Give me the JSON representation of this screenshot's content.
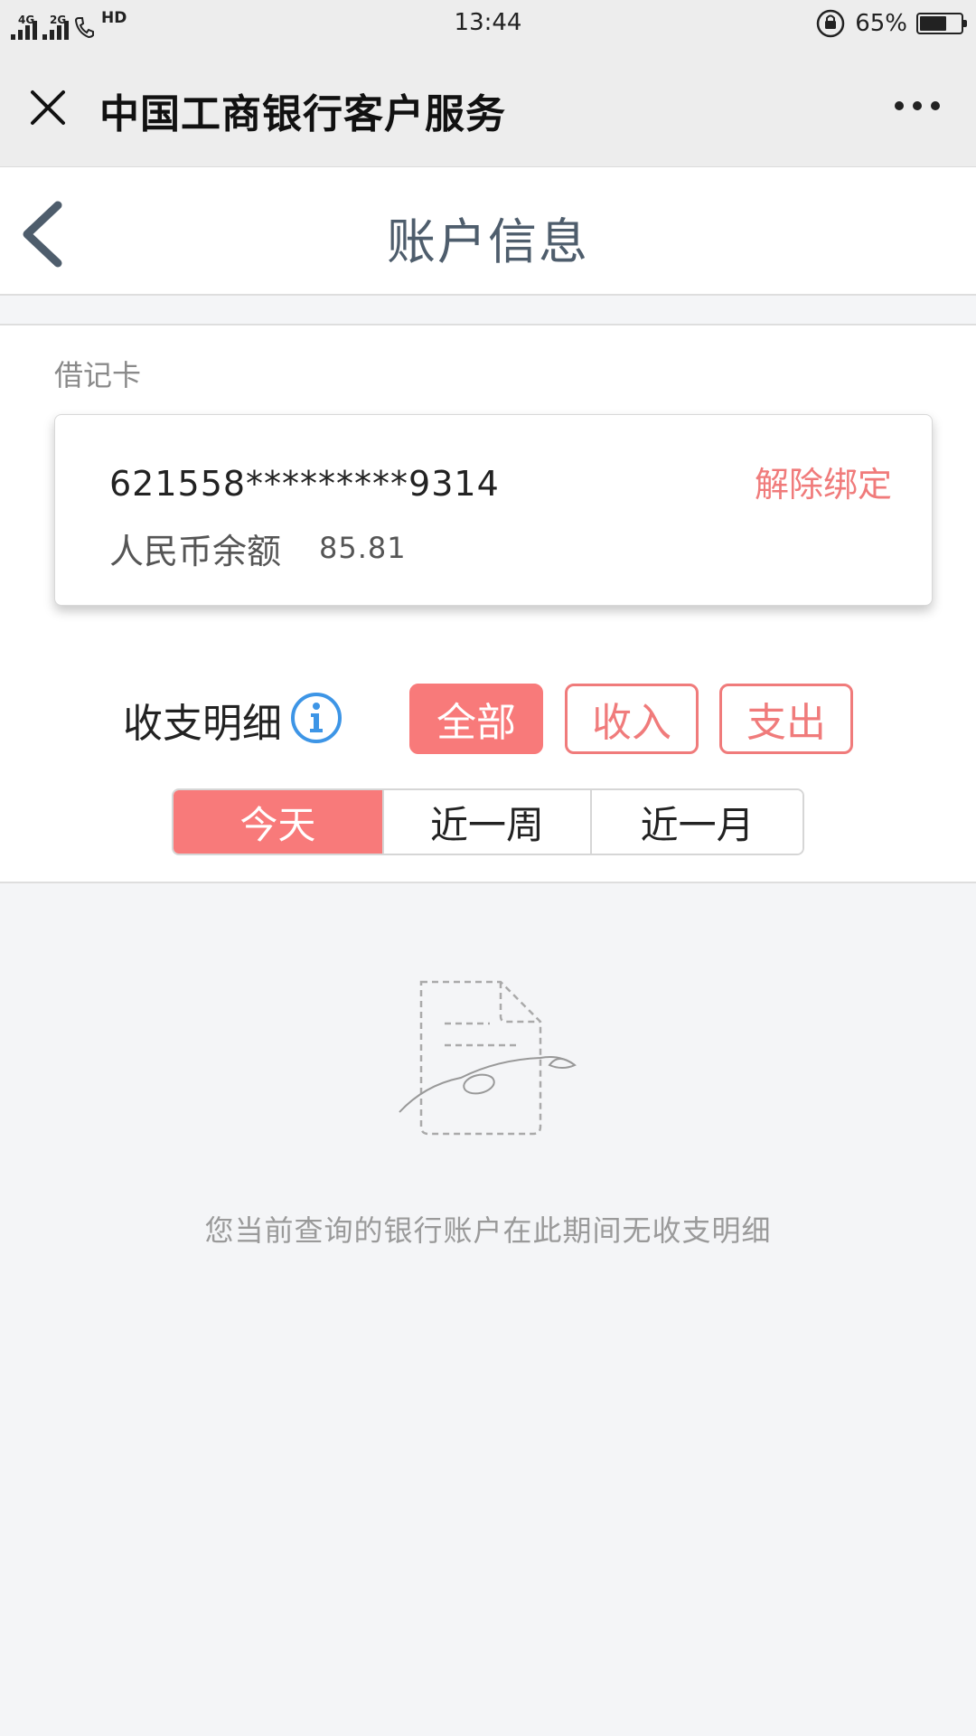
{
  "status_bar": {
    "network_1": "4G",
    "network_2": "2G",
    "hd": "HD",
    "time": "13:44",
    "battery_percent": "65%",
    "battery_level": 0.65
  },
  "header": {
    "title": "中国工商银行客户服务"
  },
  "page": {
    "title": "账户信息"
  },
  "account": {
    "card_type": "借记卡",
    "card_number": "621558*********9314",
    "unbind_label": "解除绑定",
    "balance_label": "人民币余额",
    "balance_value": "85.81"
  },
  "details": {
    "label": "收支明细",
    "type_filters": [
      {
        "label": "全部",
        "active": true
      },
      {
        "label": "收入",
        "active": false
      },
      {
        "label": "支出",
        "active": false
      }
    ],
    "period_tabs": [
      {
        "label": "今天",
        "active": true
      },
      {
        "label": "近一周",
        "active": false
      },
      {
        "label": "近一月",
        "active": false
      }
    ]
  },
  "empty_state": {
    "message": "您当前查询的银行账户在此期间无收支明细"
  },
  "colors": {
    "accent": "#f87a7a",
    "title_gray": "#4e5d6c",
    "info_blue": "#3d95e6"
  }
}
